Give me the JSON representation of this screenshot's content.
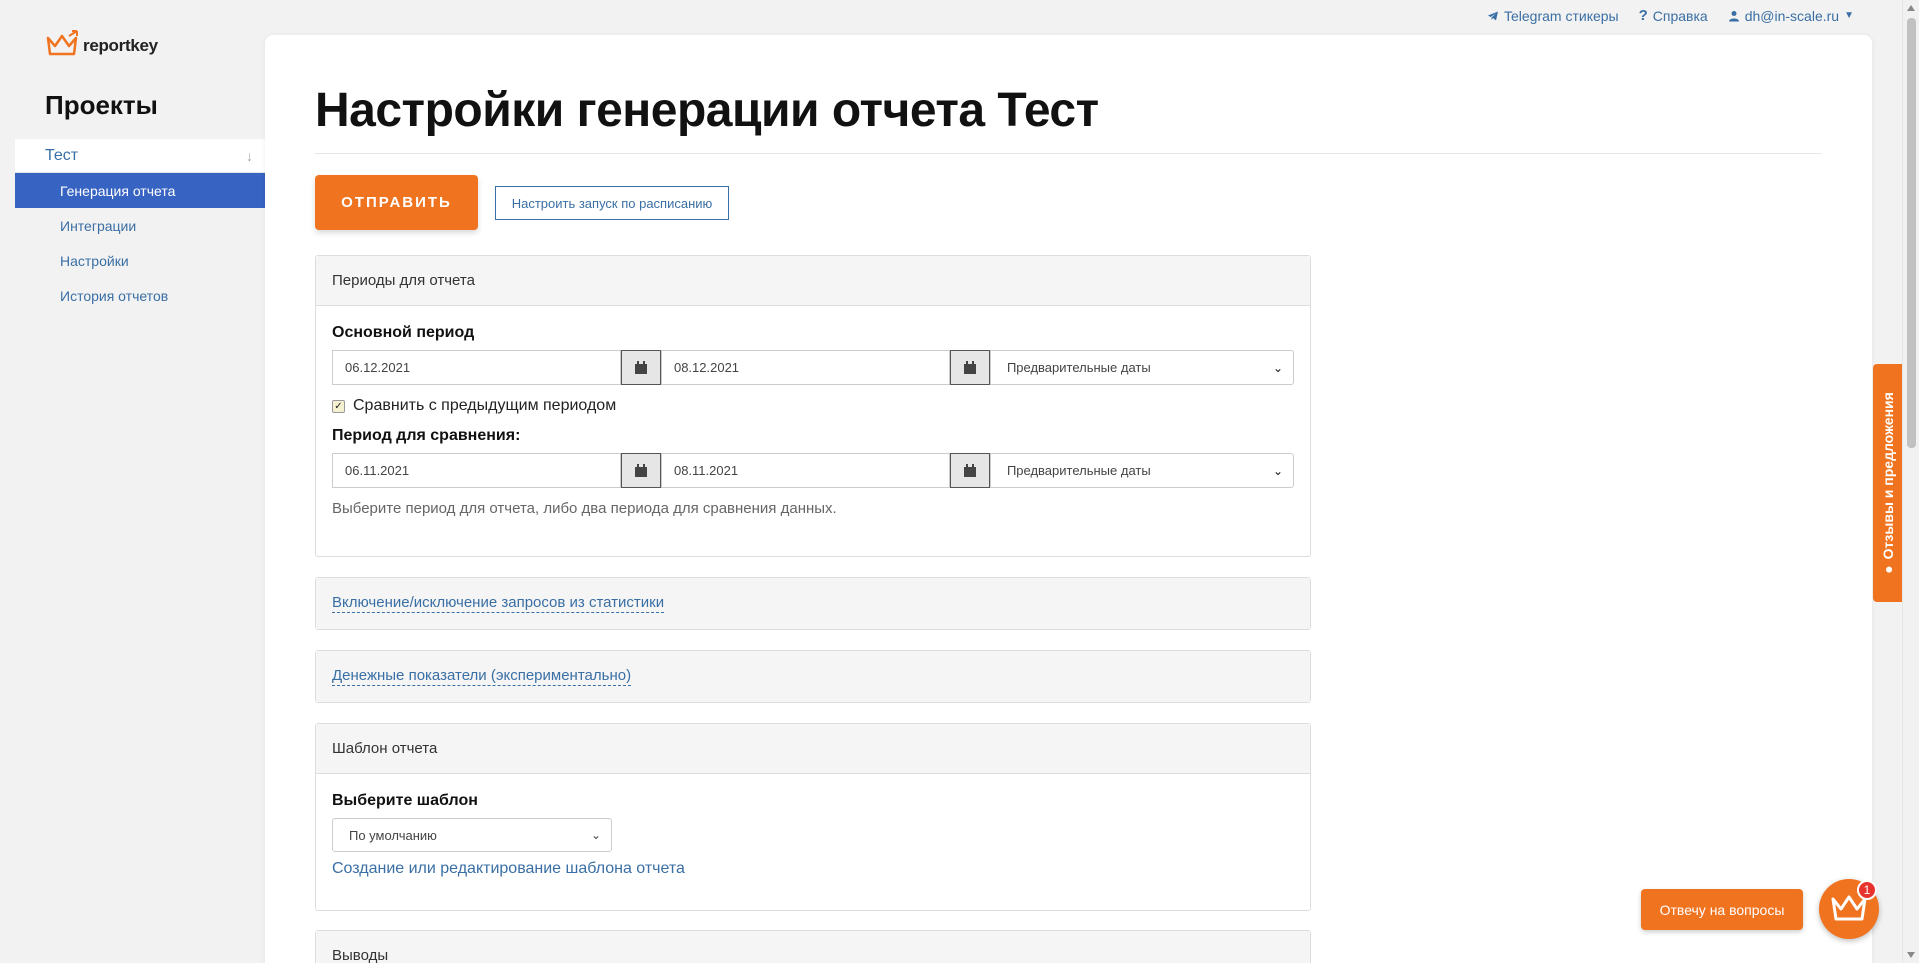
{
  "topnav": {
    "telegram": "Telegram стикеры",
    "help": "Справка",
    "user": "dh@in-scale.ru"
  },
  "logo": {
    "text": "reportkey"
  },
  "sidebar": {
    "title": "Проекты",
    "project": "Тест",
    "items": [
      {
        "label": "Генерация отчета",
        "active": true
      },
      {
        "label": "Интеграции"
      },
      {
        "label": "Настройки"
      },
      {
        "label": "История отчетов"
      }
    ]
  },
  "main": {
    "title": "Настройки генерации отчета Тест",
    "send_label": "ОТПРАВИТЬ",
    "schedule_label": "Настроить запуск по расписанию",
    "periods": {
      "header": "Периоды для отчета",
      "main_label": "Основной период",
      "main_from": "06.12.2021",
      "main_to": "08.12.2021",
      "main_preset": "Предварительные даты",
      "compare_label": "Сравнить с предыдущим периодом",
      "compare_checked": true,
      "cmp_label": "Период для сравнения:",
      "cmp_from": "06.11.2021",
      "cmp_to": "08.11.2021",
      "cmp_preset": "Предварительные даты",
      "hint": "Выберите период для отчета, либо два периода для сравнения данных."
    },
    "filter_link": "Включение/исключение запросов из статистики",
    "money_link": "Денежные показатели (экспериментально)",
    "template": {
      "header": "Шаблон отчета",
      "label": "Выберите шаблон",
      "selected": "По умолчанию",
      "edit_link": "Создание или редактирование шаблона отчета"
    },
    "conclusions_header": "Выводы"
  },
  "feedback": {
    "label": "Отзывы и предложения"
  },
  "chat": {
    "button": "Отвечу на вопросы",
    "badge": "1"
  },
  "colors": {
    "accent": "#f0731f",
    "link": "#3a6fa5",
    "active": "#3763c2"
  }
}
